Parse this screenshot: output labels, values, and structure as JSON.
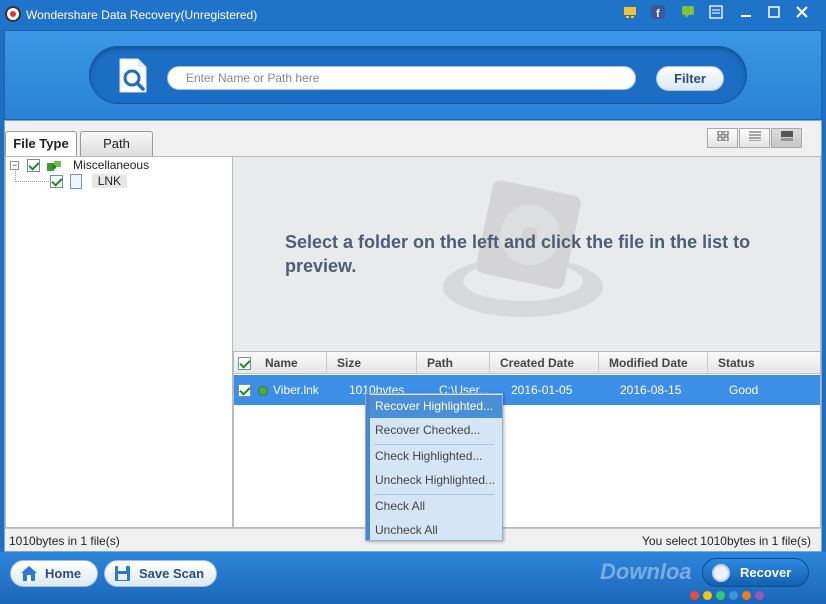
{
  "window": {
    "title": "Wondershare Data Recovery(Unregistered)"
  },
  "search": {
    "placeholder": "Enter Name or Path here",
    "filter_label": "Filter"
  },
  "tabs": [
    {
      "label": "File Type",
      "active": true
    },
    {
      "label": "Path",
      "active": false
    }
  ],
  "tree": {
    "root": {
      "label": "Miscellaneous",
      "checked": true,
      "expanded": true
    },
    "child": {
      "label": "LNK",
      "checked": true
    }
  },
  "preview": {
    "message": "Select a folder on the left and click the file in the list to preview."
  },
  "file_list": {
    "columns": [
      "Name",
      "Size",
      "Path",
      "Created Date",
      "Modified Date",
      "Status"
    ],
    "rows": [
      {
        "name": "Viber.lnk",
        "size": "1010bytes",
        "path": "C:\\User...",
        "created": "2016-01-05",
        "modified": "2016-08-15",
        "status": "Good"
      }
    ]
  },
  "context_menu": {
    "items": [
      "Recover Highlighted...",
      "Recover Checked...",
      "Check Highlighted...",
      "Uncheck Highlighted...",
      "Check All",
      "Uncheck All"
    ]
  },
  "status": {
    "left": "1010bytes in 1 file(s)",
    "right": "You select 1010bytes in 1 file(s)"
  },
  "bottom": {
    "home_label": "Home",
    "save_scan_label": "Save Scan",
    "recover_label": "Recover",
    "watermark": "Downloa"
  },
  "colors": {
    "accent": "#1f74c9",
    "selection": "#3d8ee6",
    "status_good": "#4cae3d"
  }
}
